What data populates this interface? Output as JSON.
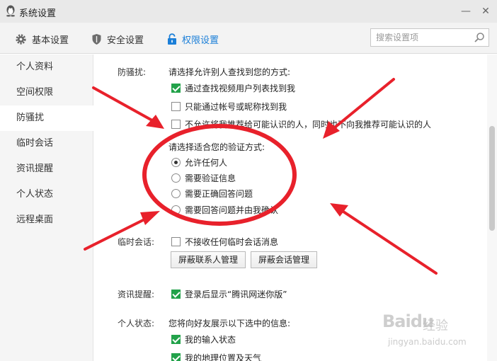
{
  "window": {
    "title": "系统设置",
    "minimize_label": "—",
    "close_label": "✕"
  },
  "toolbar": {
    "tabs": [
      {
        "label": "基本设置",
        "icon": "gear-icon",
        "active": false
      },
      {
        "label": "安全设置",
        "icon": "shield-icon",
        "active": false
      },
      {
        "label": "权限设置",
        "icon": "lock-icon",
        "active": true
      }
    ],
    "search_placeholder": "搜索设置项"
  },
  "sidebar": {
    "items": [
      {
        "label": "个人资料"
      },
      {
        "label": "空间权限"
      },
      {
        "label": "防骚扰",
        "active": true
      },
      {
        "label": "临时会话"
      },
      {
        "label": "资讯提醒"
      },
      {
        "label": "个人状态"
      },
      {
        "label": "远程桌面"
      }
    ]
  },
  "content": {
    "anti_harass": {
      "label": "防骚扰:",
      "find_prompt": "请选择允许别人查找到您的方式:",
      "find_options": [
        {
          "label": "通过查找视频用户列表找到我",
          "checked": true
        },
        {
          "label": "只能通过帐号或昵称找到我",
          "checked": false
        },
        {
          "label": "不允许将我推荐给可能认识的人，同时也不向我推荐可能认识的人",
          "checked": false
        }
      ],
      "verify_prompt": "请选择适合您的验证方式:",
      "verify_options": [
        {
          "label": "允许任何人",
          "selected": true
        },
        {
          "label": "需要验证信息",
          "selected": false
        },
        {
          "label": "需要正确回答问题",
          "selected": false
        },
        {
          "label": "需要回答问题并由我确认",
          "selected": false
        }
      ]
    },
    "temp_session": {
      "label": "临时会话:",
      "option": {
        "label": "不接收任何临时会话消息",
        "checked": false
      },
      "buttons": [
        "屏蔽联系人管理",
        "屏蔽会话管理"
      ]
    },
    "news": {
      "label": "资讯提醒:",
      "option": {
        "label": "登录后显示“腾讯网迷你版”",
        "checked": true
      }
    },
    "status": {
      "label": "个人状态:",
      "prompt": "您将向好友展示以下选中的信息:",
      "options": [
        {
          "label": "我的输入状态",
          "checked": true
        },
        {
          "label": "我的地理位置及天气",
          "checked": true
        }
      ]
    }
  },
  "annotation": {
    "color": "#e8212b"
  },
  "watermark": {
    "logo": "Baidu",
    "sub": "经验",
    "url": "jingyan.baidu.com"
  }
}
